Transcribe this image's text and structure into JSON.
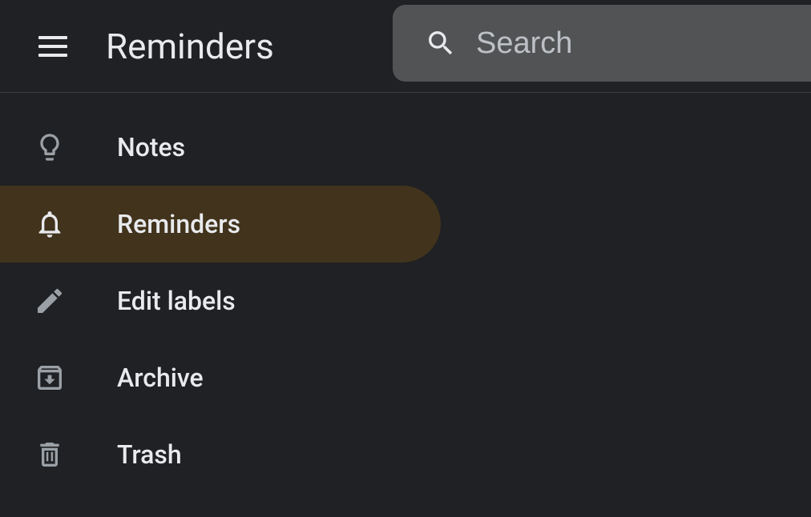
{
  "header": {
    "title": "Reminders"
  },
  "search": {
    "placeholder": "Search",
    "value": ""
  },
  "sidebar": {
    "items": [
      {
        "label": "Notes",
        "icon": "lightbulb",
        "active": false
      },
      {
        "label": "Reminders",
        "icon": "bell",
        "active": true
      },
      {
        "label": "Edit labels",
        "icon": "pencil",
        "active": false
      },
      {
        "label": "Archive",
        "icon": "archive",
        "active": false
      },
      {
        "label": "Trash",
        "icon": "trash",
        "active": false
      }
    ]
  }
}
